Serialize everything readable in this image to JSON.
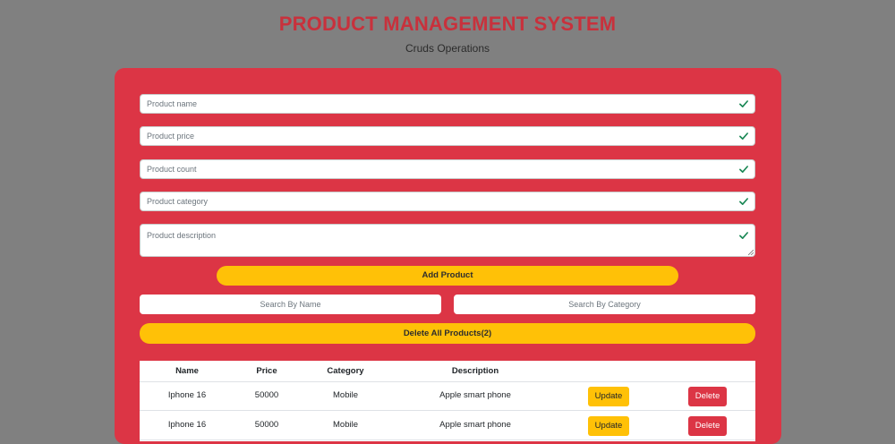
{
  "header": {
    "title": "PRODUCT MANAGEMENT SYSTEM",
    "subtitle": "Cruds Operations"
  },
  "form": {
    "name_placeholder": "Product name",
    "price_placeholder": "Product price",
    "count_placeholder": "Product count",
    "category_placeholder": "Product category",
    "description_placeholder": "Product description",
    "valid_icon": "check-icon",
    "add_label": "Add Product"
  },
  "search": {
    "by_name_label": "Search By Name",
    "by_category_label": "Search By Category"
  },
  "delete_all_label": "Delete All Products(2)",
  "table": {
    "headers": [
      "Name",
      "Price",
      "Category",
      "Description"
    ],
    "rows": [
      {
        "name": "Iphone 16",
        "price": "50000",
        "category": "Mobile",
        "description": "Apple smart phone",
        "update_label": "Update",
        "delete_label": "Delete"
      },
      {
        "name": "Iphone 16",
        "price": "50000",
        "category": "Mobile",
        "description": "Apple smart phone",
        "update_label": "Update",
        "delete_label": "Delete"
      }
    ]
  },
  "colors": {
    "page_bg": "#808080",
    "title": "#c8313c",
    "panel": "#dc3545",
    "accent_yellow": "#ffc107",
    "valid_green": "#198754",
    "delete_red": "#dc3545"
  }
}
